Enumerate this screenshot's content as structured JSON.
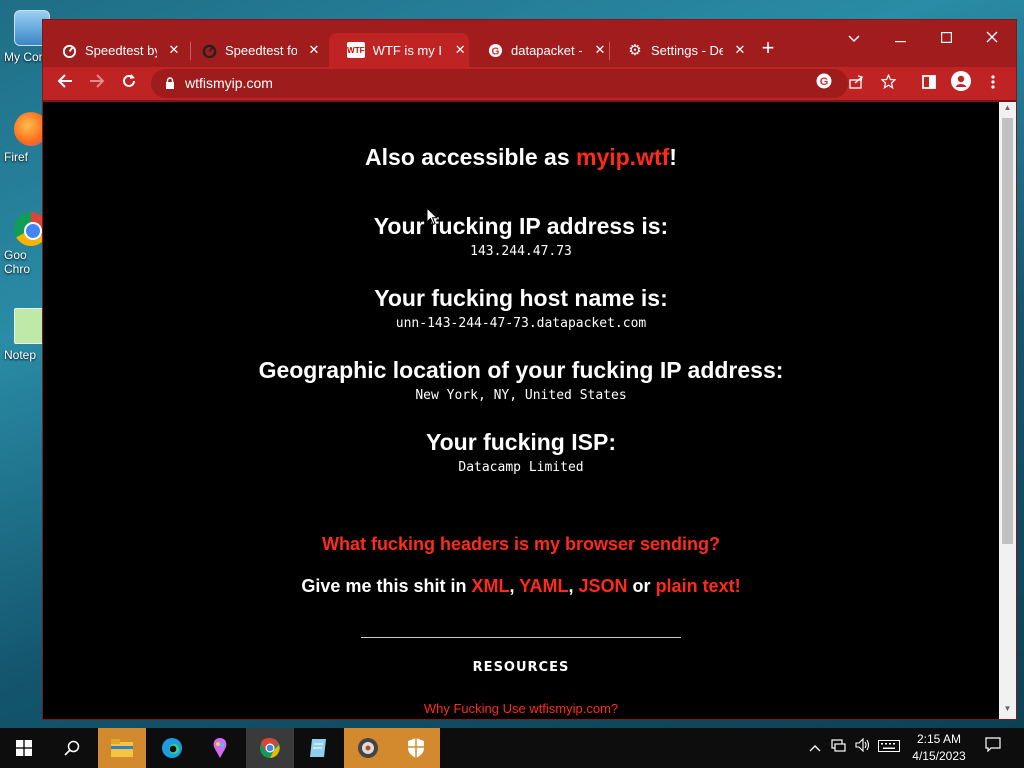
{
  "desktop": {
    "icons": [
      {
        "label": "My Com",
        "icon": "computer-icon"
      },
      {
        "label": "Firef",
        "icon": "firefox-icon"
      },
      {
        "label": "Goo Chro",
        "label_line1": "Goo",
        "label_line2": "Chro",
        "icon": "chrome-icon"
      },
      {
        "label": "Notep",
        "icon": "notepad-icon"
      }
    ]
  },
  "browser": {
    "tabs": [
      {
        "title": "Speedtest by O",
        "favicon": "speedtest-icon",
        "active": false
      },
      {
        "title": "Speedtest for",
        "favicon": "speedtest-dark-icon",
        "active": false
      },
      {
        "title": "WTF is my IP?!",
        "favicon": "wtf-icon",
        "favicon_text": "WTF",
        "active": true
      },
      {
        "title": "datapacket - G",
        "favicon": "google-icon",
        "active": false
      },
      {
        "title": "Settings - DeL",
        "favicon": "gear-icon",
        "active": false
      }
    ],
    "new_tab": "+",
    "window_controls": {
      "dropdown": "⌄",
      "minimize": "—",
      "maximize": "☐",
      "close": "✕"
    },
    "url": "wtfismyip.com",
    "colors": {
      "frame": "#a11d1d",
      "toolbar": "#bf2323",
      "accent": "#ff2a1a"
    }
  },
  "page": {
    "also_prefix": "Also accessible as ",
    "also_link": "myip.wtf",
    "also_suffix": "!",
    "ip_heading": "Your fucking IP address is:",
    "ip_value": "143.244.47.73",
    "host_heading": "Your fucking host name is:",
    "host_value": "unn-143-244-47-73.datapacket.com",
    "geo_heading": "Geographic location of your fucking IP address:",
    "geo_value": "New York, NY, United States",
    "isp_heading": "Your fucking ISP:",
    "isp_value": "Datacamp Limited",
    "headers_link": "What fucking headers is my browser sending?",
    "give_prefix": "Give me this shit in ",
    "fmt_xml": "XML",
    "sep1": ", ",
    "fmt_yaml": "YAML",
    "sep2": ", ",
    "fmt_json": "JSON",
    "or_text": " or ",
    "fmt_plain": "plain text!",
    "resources": "RESOURCES",
    "why_link": "Why Fucking Use wtfismyip.com?"
  },
  "taskbar": {
    "items": [
      "windows-start-icon",
      "search-icon",
      "file-explorer-icon",
      "edge-icon",
      "paint-icon",
      "chrome-icon",
      "notepad-icon",
      "media-icon",
      "security-icon"
    ],
    "clock_time": "2:15 AM",
    "clock_date": "4/15/2023"
  }
}
